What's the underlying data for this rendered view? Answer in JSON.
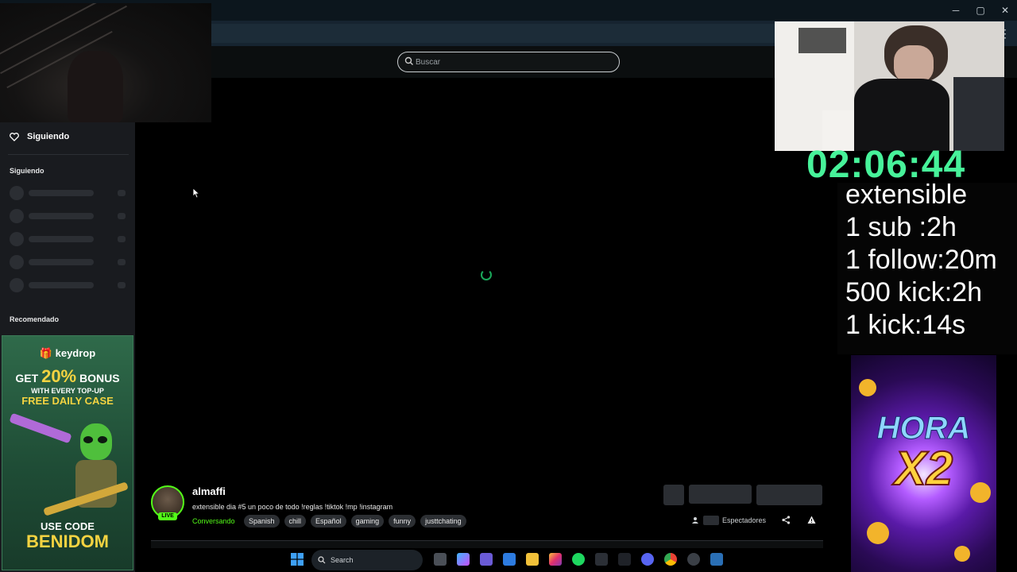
{
  "window": {
    "minimize": "─",
    "maximize": "▢",
    "close": "✕",
    "menu": "⋮"
  },
  "header": {
    "search_placeholder": "Buscar"
  },
  "sidebar": {
    "following_button": "Siguiendo",
    "following_section": "Siguiendo",
    "recommended_section": "Recomendado"
  },
  "overlay": {
    "timer": "02:06:44",
    "lines": [
      "extensible",
      "1 sub :2h",
      "1 follow:20m",
      "500 kick:2h",
      "1 kick:14s"
    ]
  },
  "ads": {
    "left": {
      "brand": "keydrop",
      "line1_prefix": "GET ",
      "line1_big": "20%",
      "line1_suffix": " BONUS",
      "line2": "WITH EVERY TOP-UP",
      "line3": "FREE DAILY CASE",
      "use_code": "USE CODE",
      "code": "BENIDOM"
    },
    "right": {
      "line1": "HORA",
      "line2": "X2"
    }
  },
  "stream": {
    "channel": "almaffi",
    "live_badge": "LIVE",
    "title": "extensible dia #5 un poco de todo !reglas !tiktok !mp !instagram",
    "category": "Conversando",
    "tags": [
      "Spanish",
      "chill",
      "Español",
      "gaming",
      "funny",
      "justtchating"
    ],
    "viewers_label": "Espectadores"
  },
  "taskbar": {
    "search_label": "Search"
  }
}
